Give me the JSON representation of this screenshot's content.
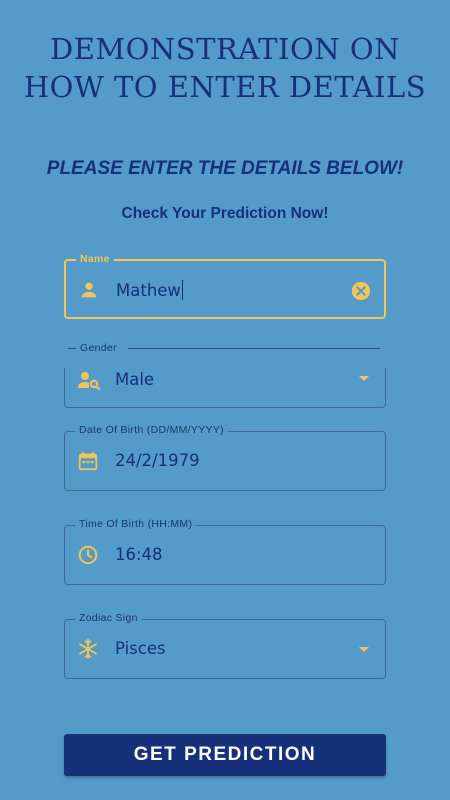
{
  "header": {
    "title_line1": "DEMONSTRATION ON",
    "title_line2": "HOW TO ENTER DETAILS",
    "subtitle": "PLEASE ENTER THE DETAILS BELOW!",
    "tagline": "Check Your Prediction Now!"
  },
  "form": {
    "name": {
      "label": "Name",
      "value": "Mathew",
      "icon": "person-icon",
      "clear_icon": "clear-icon"
    },
    "gender": {
      "label": "Gender",
      "value": "Male",
      "icon": "person-search-icon"
    },
    "dob": {
      "label": "Date Of Birth (DD/MM/YYYY)",
      "value": "24/2/1979",
      "icon": "calendar-icon"
    },
    "tob": {
      "label": "Time Of Birth (HH:MM)",
      "value": "16:48",
      "icon": "clock-icon"
    },
    "zodiac": {
      "label": "Zodiac Sign",
      "value": "Pisces",
      "icon": "snowflake-icon"
    }
  },
  "actions": {
    "submit_label": "GET PREDICTION"
  },
  "colors": {
    "background": "#559bc9",
    "primary": "#16307a",
    "accent": "#f2c45a",
    "border": "#3d6a91"
  }
}
